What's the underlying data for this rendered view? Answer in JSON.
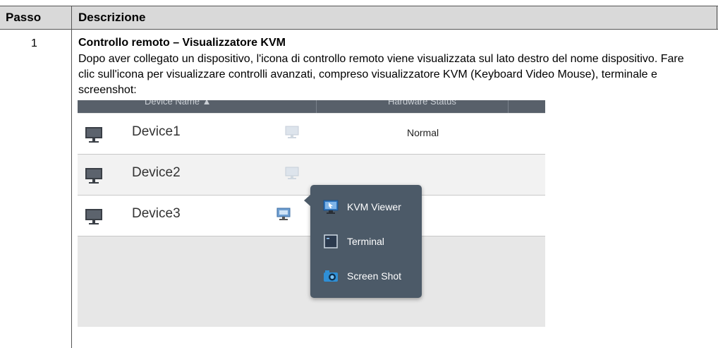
{
  "table": {
    "header": {
      "col1": "Passo",
      "col2": "Descrizione"
    },
    "row": {
      "step": "1",
      "title": "Controllo remoto – Visualizzatore KVM",
      "description": "Dopo aver collegato un dispositivo, l'icona di controllo remoto viene visualizzata sul lato destro del nome dispositivo. Fare clic sull'icona per visualizzare controlli avanzati, compreso visualizzatore KVM (Keyboard Video Mouse), terminale e screenshot:"
    }
  },
  "screenshot": {
    "columns": [
      "Device Name ▲",
      "Hardware Status"
    ],
    "devices": [
      {
        "name": "Device1",
        "status": "Normal"
      },
      {
        "name": "Device2",
        "status": ""
      },
      {
        "name": "Device3",
        "status": ""
      }
    ],
    "menu": [
      {
        "label": "KVM Viewer",
        "icon": "kvm-viewer-icon"
      },
      {
        "label": "Terminal",
        "icon": "terminal-icon"
      },
      {
        "label": "Screen Shot",
        "icon": "camera-icon"
      }
    ]
  }
}
